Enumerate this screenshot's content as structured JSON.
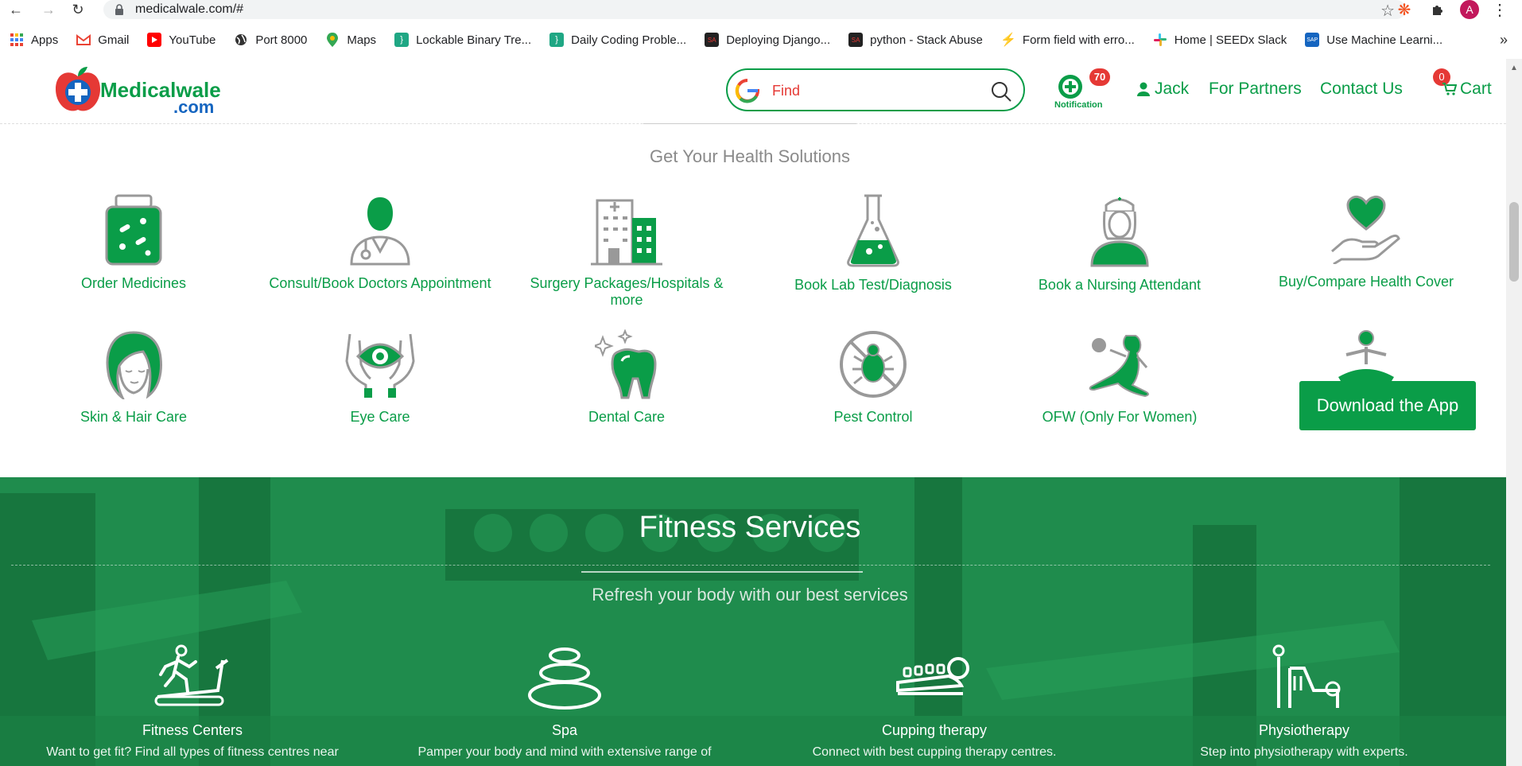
{
  "browser": {
    "url": "medicalwale.com/#",
    "profile_initial": "A",
    "bookmarks": [
      {
        "label": "Apps",
        "icon": "apps-grid-icon"
      },
      {
        "label": "Gmail",
        "icon": "gmail-icon"
      },
      {
        "label": "YouTube",
        "icon": "youtube-icon"
      },
      {
        "label": "Port 8000",
        "icon": "globe-icon"
      },
      {
        "label": "Maps",
        "icon": "maps-pin-icon"
      },
      {
        "label": "Lockable Binary Tre...",
        "icon": "code-bracket-icon"
      },
      {
        "label": "Daily Coding Proble...",
        "icon": "code-bracket-icon"
      },
      {
        "label": "Deploying Django...",
        "icon": "stackabuse-icon"
      },
      {
        "label": "python - Stack Abuse",
        "icon": "stackabuse-icon"
      },
      {
        "label": "Form field with erro...",
        "icon": "lightning-icon"
      },
      {
        "label": "Home | SEEDx Slack",
        "icon": "slack-icon"
      },
      {
        "label": "Use Machine Learni...",
        "icon": "sap-icon"
      }
    ],
    "more": "»"
  },
  "header": {
    "logo_part1": "Medicalwale",
    "logo_part2": ".com",
    "search_placeholder": "Find",
    "notification_count": "70",
    "notification_label": "Notification",
    "user": "Jack",
    "partners": "For Partners",
    "contact": "Contact Us",
    "cart_count": "0",
    "cart": "Cart"
  },
  "health": {
    "title": "Get Your Health Solutions",
    "services": [
      {
        "label": "Order Medicines",
        "icon": "medicine-jar-icon"
      },
      {
        "label": "Consult/Book Doctors Appointment",
        "icon": "doctor-icon"
      },
      {
        "label": "Surgery Packages/Hospitals & more",
        "icon": "hospital-icon"
      },
      {
        "label": "Book Lab Test/Diagnosis",
        "icon": "lab-flask-icon"
      },
      {
        "label": "Book a Nursing Attendant",
        "icon": "nurse-icon"
      },
      {
        "label": "Buy/Compare Health Cover",
        "icon": "heart-hand-icon"
      },
      {
        "label": "Skin & Hair Care",
        "icon": "woman-face-icon"
      },
      {
        "label": "Eye Care",
        "icon": "eye-hands-icon"
      },
      {
        "label": "Dental Care",
        "icon": "tooth-icon"
      },
      {
        "label": "Pest Control",
        "icon": "pest-control-icon"
      },
      {
        "label": "OFW (Only For Women)",
        "icon": "woman-figure-icon"
      }
    ],
    "download_app": "Download the App"
  },
  "fitness": {
    "title": "Fitness Services",
    "subtitle": "Refresh your body with our best services",
    "services": [
      {
        "name": "Fitness Centers",
        "desc": "Want to get fit? Find all types of fitness centres near",
        "icon": "treadmill-icon"
      },
      {
        "name": "Spa",
        "desc": "Pamper your body and mind with extensive range of",
        "icon": "spa-stones-icon"
      },
      {
        "name": "Cupping therapy",
        "desc": "Connect with best cupping therapy centres.",
        "icon": "cupping-icon"
      },
      {
        "name": "Physiotherapy",
        "desc": "Step into physiotherapy with experts.",
        "icon": "physiotherapy-icon"
      }
    ]
  },
  "colors": {
    "brand_green": "#0a9d48",
    "alert_red": "#e53935",
    "logo_blue": "#1565c0"
  }
}
